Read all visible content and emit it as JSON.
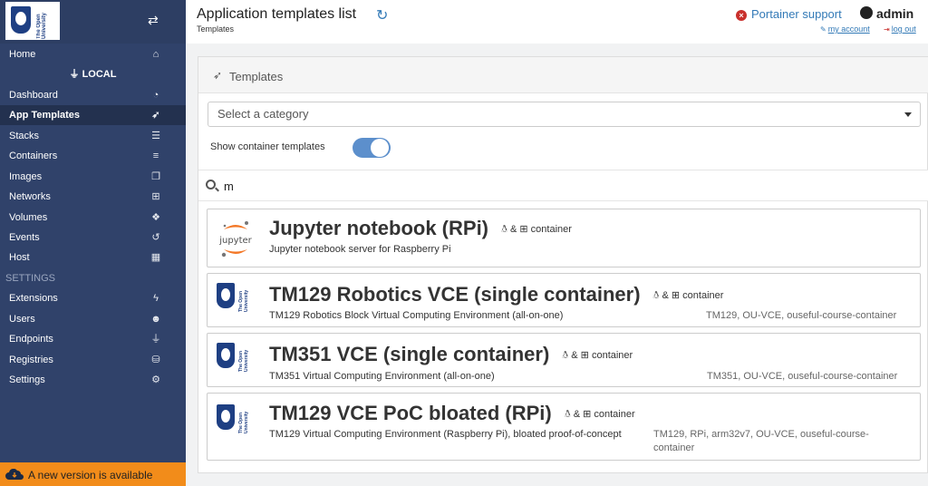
{
  "sidebar": {
    "logo_text": "The Open University",
    "home": "Home",
    "endpoint": "LOCAL",
    "items": [
      {
        "label": "Dashboard",
        "icon": "dashboard-icon"
      },
      {
        "label": "App Templates",
        "icon": "rocket-icon"
      },
      {
        "label": "Stacks",
        "icon": "th-list-icon"
      },
      {
        "label": "Containers",
        "icon": "server-icon"
      },
      {
        "label": "Images",
        "icon": "clone-icon"
      },
      {
        "label": "Networks",
        "icon": "sitemap-icon"
      },
      {
        "label": "Volumes",
        "icon": "cubes-icon"
      },
      {
        "label": "Events",
        "icon": "history-icon"
      },
      {
        "label": "Host",
        "icon": "th-icon"
      }
    ],
    "settings_header": "SETTINGS",
    "settings_items": [
      {
        "label": "Extensions",
        "icon": "bolt-icon"
      },
      {
        "label": "Users",
        "icon": "users-icon"
      },
      {
        "label": "Endpoints",
        "icon": "plug-icon"
      },
      {
        "label": "Registries",
        "icon": "database-icon"
      },
      {
        "label": "Settings",
        "icon": "cogs-icon"
      }
    ],
    "update_banner": "A new version is available"
  },
  "header": {
    "title": "Application templates list",
    "breadcrumb": "Templates",
    "support": "Portainer support",
    "user": "admin",
    "my_account": "my account",
    "logout": "log out"
  },
  "panel": {
    "title": "Templates",
    "category_placeholder": "Select a category",
    "toggle_label": "Show container templates",
    "toggle_on": true,
    "search_value": "m"
  },
  "templates": [
    {
      "title": "Jupyter notebook (RPi)",
      "platform": "& ",
      "type": "container",
      "description": "Jupyter notebook server for Raspberry Pi",
      "categories": "",
      "logo": "jupyter"
    },
    {
      "title": "TM129 Robotics VCE (single container)",
      "platform": "& ",
      "type": "container",
      "description": "TM129 Robotics Block Virtual Computing Environment (all-on-one)",
      "categories": "TM129, OU-VCE, ouseful-course-container",
      "logo": "ou"
    },
    {
      "title": "TM351 VCE (single container)",
      "platform": "& ",
      "type": "container",
      "description": "TM351 Virtual Computing Environment (all-on-one)",
      "categories": "TM351, OU-VCE, ouseful-course-container",
      "logo": "ou"
    },
    {
      "title": "TM129 VCE PoC bloated (RPi)",
      "platform": "& ",
      "type": "container",
      "description": "TM129 Virtual Computing Environment (Raspberry Pi), bloated proof-of-concept",
      "categories": "TM129, RPi, arm32v7, OU-VCE, ouseful-course-container",
      "logo": "ou"
    }
  ],
  "colors": {
    "sidebar_bg": "#30426a",
    "active_item_bg": "#23314f",
    "banner_bg": "#f28c1a",
    "link": "#337ab7",
    "toggle_on": "#5c8fcc"
  }
}
